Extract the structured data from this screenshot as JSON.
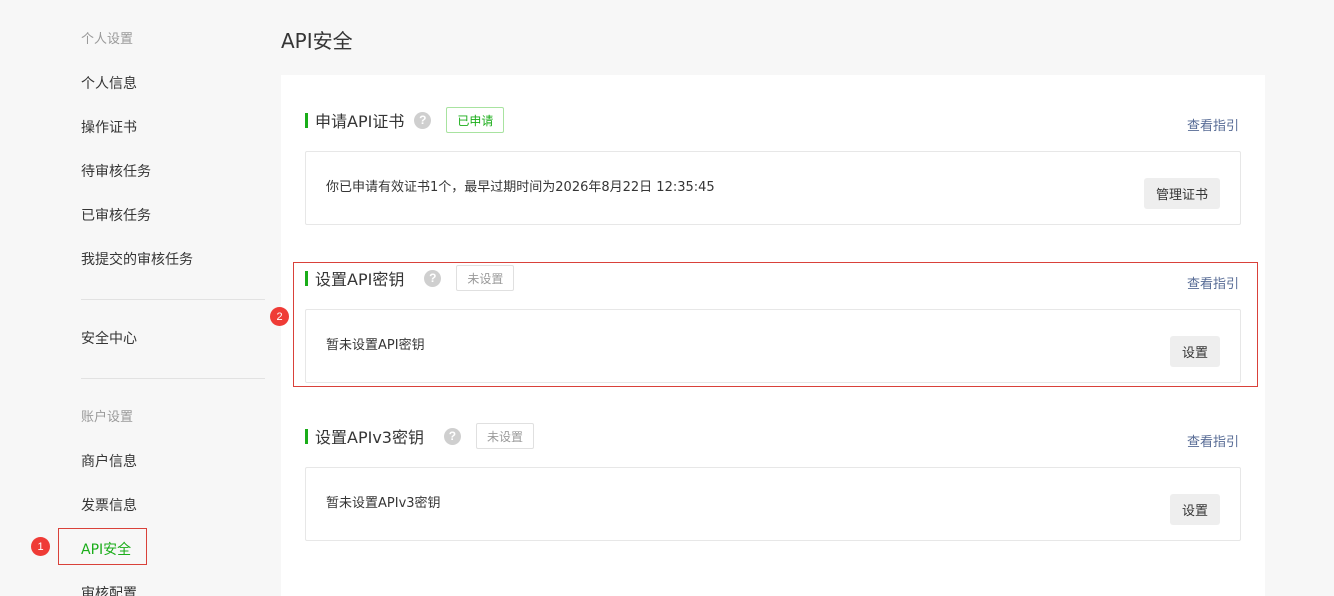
{
  "page": {
    "title": "API安全"
  },
  "sidebar": {
    "group_personal": "个人设置",
    "items_personal": [
      "个人信息",
      "操作证书",
      "待审核任务",
      "已审核任务",
      "我提交的审核任务"
    ],
    "security_center": "安全中心",
    "group_account": "账户设置",
    "items_account": [
      "商户信息",
      "发票信息",
      "API安全",
      "审核配置"
    ],
    "active_item": "API安全"
  },
  "sections": [
    {
      "title": "申请API证书",
      "status": "已申请",
      "guide": "查看指引",
      "message": "你已申请有效证书1个，最早过期时间为2026年8月22日 12:35:45",
      "button": "管理证书"
    },
    {
      "title": "设置API密钥",
      "status": "未设置",
      "guide": "查看指引",
      "message": "暂未设置API密钥",
      "button": "设置"
    },
    {
      "title": "设置APIv3密钥",
      "status": "未设置",
      "guide": "查看指引",
      "message": "暂未设置APIv3密钥",
      "button": "设置"
    }
  ],
  "icons": {
    "help": "question-mark-icon",
    "help_glyph": "?"
  },
  "annotations": [
    "1",
    "2"
  ],
  "colors": {
    "accent": "#1aad19",
    "link": "#576b95",
    "highlight": "#d9413a",
    "marker": "#ef3b36"
  }
}
